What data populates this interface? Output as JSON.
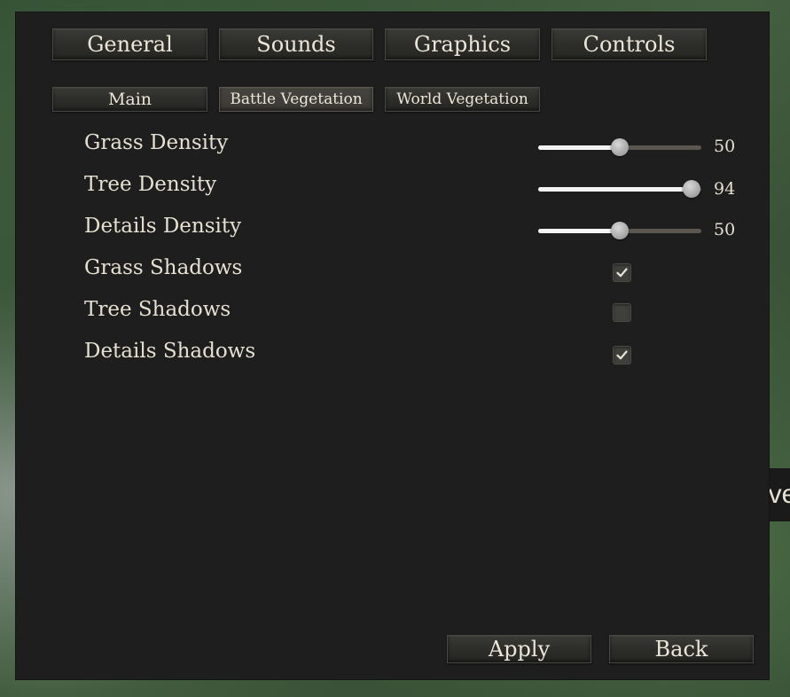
{
  "tabs": [
    {
      "label": "General"
    },
    {
      "label": "Sounds"
    },
    {
      "label": "Graphics"
    },
    {
      "label": "Controls"
    }
  ],
  "subtabs": [
    {
      "label": "Main"
    },
    {
      "label": "Battle Vegetation",
      "active": true
    },
    {
      "label": "World Vegetation"
    }
  ],
  "settings": {
    "grass_density": {
      "label": "Grass Density",
      "value": 50,
      "max": 100
    },
    "tree_density": {
      "label": "Tree Density",
      "value": 94,
      "max": 100
    },
    "details_density": {
      "label": "Details Density",
      "value": 50,
      "max": 100
    },
    "grass_shadows": {
      "label": "Grass Shadows",
      "checked": true
    },
    "tree_shadows": {
      "label": "Tree Shadows",
      "checked": false
    },
    "details_shadows": {
      "label": "Details Shadows",
      "checked": true
    }
  },
  "actions": {
    "apply_label": "Apply",
    "back_label": "Back"
  },
  "background_text": "lve",
  "colors": {
    "panel_bg": "#1e1e1e",
    "text": "#e6e0d2",
    "slider_fill": "#f4f4f4",
    "slider_track": "#5b5650"
  }
}
